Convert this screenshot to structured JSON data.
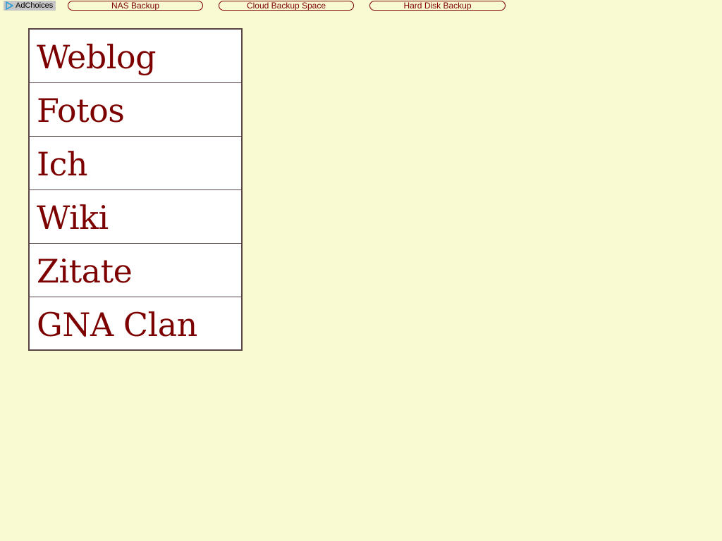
{
  "ad_bar": {
    "adchoices_label": "AdChoices",
    "adchoices_icon": "play-triangle-icon",
    "links": [
      {
        "label": "NAS Backup"
      },
      {
        "label": "Cloud Backup Space"
      },
      {
        "label": "Hard Disk Backup"
      }
    ]
  },
  "menu": {
    "items": [
      {
        "label": "Weblog"
      },
      {
        "label": "Fotos"
      },
      {
        "label": "Ich"
      },
      {
        "label": "Wiki"
      },
      {
        "label": "Zitate"
      },
      {
        "label": "GNA Clan"
      }
    ]
  },
  "colors": {
    "background": "#f9f9d2",
    "link": "#7d0000",
    "menu_border": "#5a4545",
    "menu_background": "#ffffff",
    "adchoices_background": "#c6c6c6",
    "adchoices_icon": "#2a9fd6"
  }
}
